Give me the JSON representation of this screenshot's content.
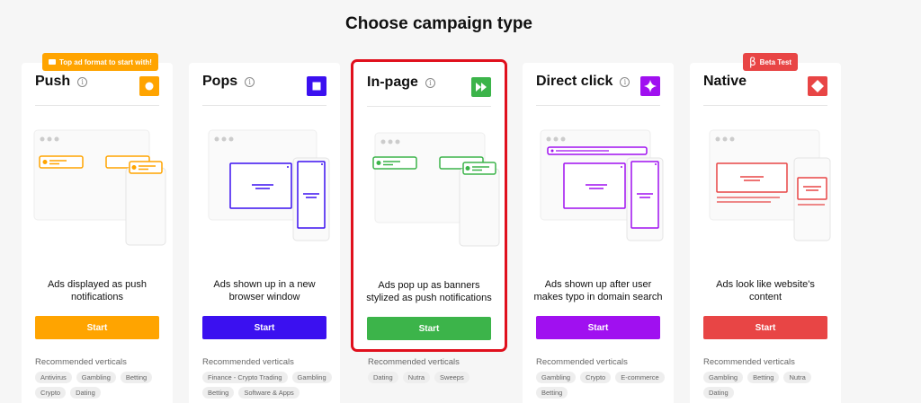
{
  "page_title": "Choose campaign type",
  "cards": [
    {
      "name": "Push",
      "description": "Ads displayed as push notifications",
      "start_label": "Start",
      "recommended_label": "Recommended verticals",
      "tags": [
        "Antivirus",
        "Gambling",
        "Betting",
        "Crypto",
        "Dating"
      ],
      "color": "#ffa400",
      "icon": "push-icon",
      "banner": "Top ad format to start with!",
      "selected": false
    },
    {
      "name": "Pops",
      "description": "Ads shown up in a new browser window",
      "start_label": "Start",
      "recommended_label": "Recommended verticals",
      "tags": [
        "Finance - Crypto Trading",
        "Gambling",
        "Betting",
        "Software & Apps"
      ],
      "color": "#3b10f0",
      "icon": "pops-icon",
      "selected": false
    },
    {
      "name": "In-page",
      "description": "Ads pop up as banners stylized as push notifications",
      "start_label": "Start",
      "recommended_label": "Recommended verticals",
      "tags": [
        "Dating",
        "Nutra",
        "Sweeps"
      ],
      "color": "#3cb44a",
      "icon": "fast-forward-icon",
      "selected": true
    },
    {
      "name": "Direct click",
      "description": "Ads shown up after user makes typo in domain search",
      "start_label": "Start",
      "recommended_label": "Recommended verticals",
      "tags": [
        "Gambling",
        "Crypto",
        "E-commerce",
        "Betting"
      ],
      "color": "#a010f0",
      "icon": "sparkle-icon",
      "selected": false
    },
    {
      "name": "Native",
      "description": "Ads look like website's content",
      "start_label": "Start",
      "recommended_label": "Recommended verticals",
      "tags": [
        "Gambling",
        "Betting",
        "Nutra",
        "Dating"
      ],
      "color": "#e84545",
      "icon": "diamond-icon",
      "banner": "Beta Test",
      "banner_symbol": "β",
      "selected": false
    }
  ]
}
